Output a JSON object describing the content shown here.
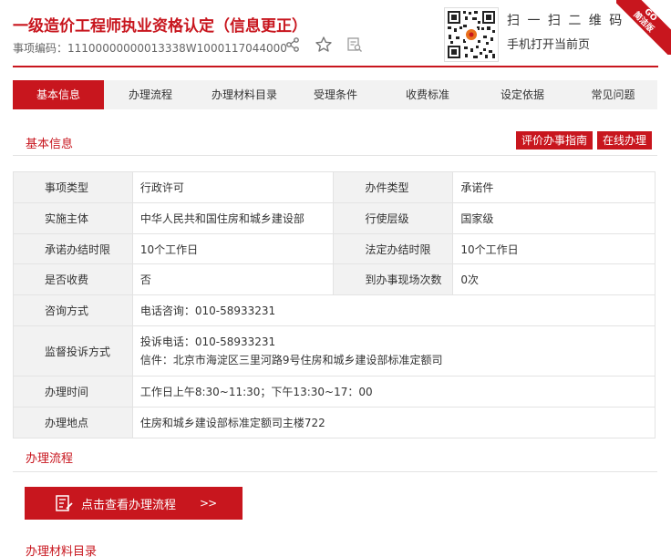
{
  "header": {
    "title": "一级造价工程师执业资格认定（信息更正）",
    "code_label": "事项编码：",
    "code_value": "11100000000013338W1000117044000",
    "scan_line1": "扫 一 扫 二 维 码",
    "scan_line2": "手机打开当前页",
    "ribbon_top": "GO",
    "ribbon_text": "简洁版"
  },
  "tabs": [
    "基本信息",
    "办理流程",
    "办理材料目录",
    "受理条件",
    "收费标准",
    "设定依据",
    "常见问题"
  ],
  "basic": {
    "title": "基本信息",
    "btn_evaluate": "评价办事指南",
    "btn_online": "在线办理"
  },
  "info": {
    "r1": {
      "l1": "事项类型",
      "v1": "行政许可",
      "l2": "办件类型",
      "v2": "承诺件"
    },
    "r2": {
      "l1": "实施主体",
      "v1": "中华人民共和国住房和城乡建设部",
      "l2": "行使层级",
      "v2": "国家级"
    },
    "r3": {
      "l1": "承诺办结时限",
      "v1": "10个工作日",
      "l2": "法定办结时限",
      "v2": "10个工作日"
    },
    "r4": {
      "l1": "是否收费",
      "v1": "否",
      "l2": "到办事现场次数",
      "v2": "0次"
    },
    "r5": {
      "l1": "咨询方式",
      "v1": "电话咨询：010-58933231"
    },
    "r6": {
      "l1": "监督投诉方式",
      "v1a": "投诉电话：010-58933231",
      "v1b": "信件：北京市海淀区三里河路9号住房和城乡建设部标准定额司"
    },
    "r7": {
      "l1": "办理时间",
      "v1": "工作日上午8:30~11:30；下午13:30~17：00"
    },
    "r8": {
      "l1": "办理地点",
      "v1": "住房和城乡建设部标准定额司主楼722"
    }
  },
  "flow": {
    "title": "办理流程",
    "button": "点击查看办理流程",
    "arrow": ">>"
  },
  "materials": {
    "title": "办理材料目录"
  },
  "colors": {
    "brand_red": "#c8161e",
    "label_bg": "#f2f2f2",
    "border": "#e3e3e3"
  }
}
